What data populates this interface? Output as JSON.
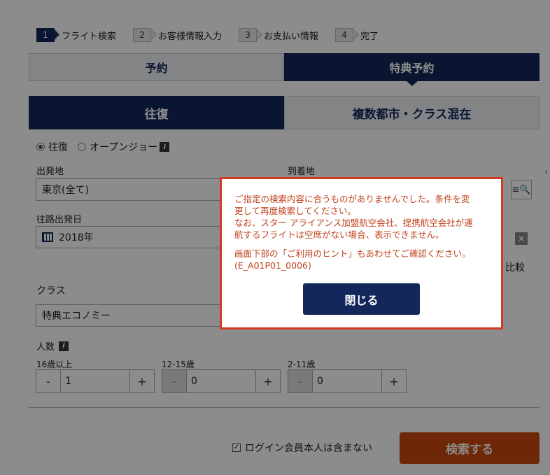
{
  "steps": [
    {
      "num": "1",
      "label": "フライト検索"
    },
    {
      "num": "2",
      "label": "お客様情報入力"
    },
    {
      "num": "3",
      "label": "お支払い情報"
    },
    {
      "num": "4",
      "label": "完了"
    }
  ],
  "top_tabs": {
    "reserve": "予約",
    "award": "特典予約"
  },
  "trip_tabs": {
    "round_trip": "往復",
    "multi_city": "複数都市・クラス混在"
  },
  "trip_radios": {
    "round_trip": "往復",
    "open_jaw": "オープンジョー"
  },
  "info_icon_glyph": "i",
  "departure": {
    "label": "出発地",
    "value": "東京(全て)"
  },
  "arrival": {
    "label": "到着地"
  },
  "outbound_date": {
    "label": "往路出発日",
    "value": "2018年"
  },
  "compare_fragment": "比較",
  "class_field": {
    "label": "クラス",
    "value": "特典エコノミー"
  },
  "passengers": {
    "label": "人数",
    "groups": [
      {
        "label": "16歳以上",
        "value": "1",
        "minus": "-",
        "plus": "+"
      },
      {
        "label": "12-15歳",
        "value": "0",
        "minus": "-",
        "plus": "+"
      },
      {
        "label": "2-11歳",
        "value": "0",
        "minus": "-",
        "plus": "+"
      }
    ]
  },
  "exclude_self_checkbox": {
    "label": "ログイン会員本人は含まない",
    "checked": true
  },
  "search_button": "検索する",
  "modal": {
    "line1": "ご指定の検索内容に合うものがありませんでした。条件を変",
    "line2": "更して再度検索してください。",
    "line3": "なお、スター アライアンス加盟航空会社、提携航空会社が運",
    "line4": "航するフライトは空席がない場合、表示できません。",
    "line5": "画面下部の「ご利用のヒント」もあわせてご確認ください。",
    "code": "(E_A01P01_0006)",
    "close_button": "閉じる"
  },
  "colors": {
    "navy": "#13275a",
    "orange": "#c84a0d",
    "error_red": "#c0421c",
    "modal_border": "#d33a1f"
  }
}
